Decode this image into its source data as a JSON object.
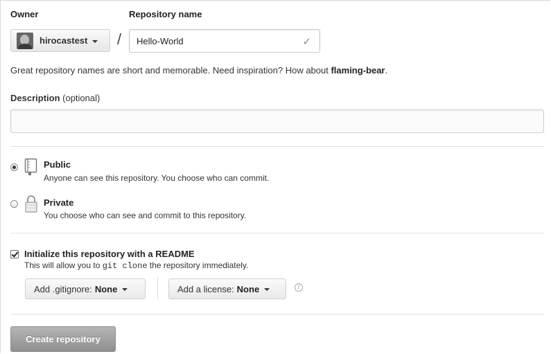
{
  "owner": {
    "label": "Owner",
    "selected": "hirocastest"
  },
  "repository": {
    "label": "Repository name",
    "separator": "/",
    "value": "Hello-World"
  },
  "hint": {
    "text": "Great repository names are short and memorable. Need inspiration? How about ",
    "suggestion": "flaming-bear",
    "end": "."
  },
  "description": {
    "label": "Description",
    "optional": "(optional)",
    "value": ""
  },
  "visibility": {
    "public": {
      "title": "Public",
      "desc": "Anyone can see this repository. You choose who can commit.",
      "selected": true
    },
    "private": {
      "title": "Private",
      "desc": "You choose who can see and commit to this repository.",
      "selected": false
    }
  },
  "readme": {
    "title": "Initialize this repository with a README",
    "desc_pre": "This will allow you to",
    "desc_code": "git clone",
    "desc_post": "the repository immediately.",
    "checked": true
  },
  "gitignore": {
    "label": "Add .gitignore:",
    "value": "None"
  },
  "license": {
    "label": "Add a license:",
    "value": "None"
  },
  "create_button": "Create repository"
}
